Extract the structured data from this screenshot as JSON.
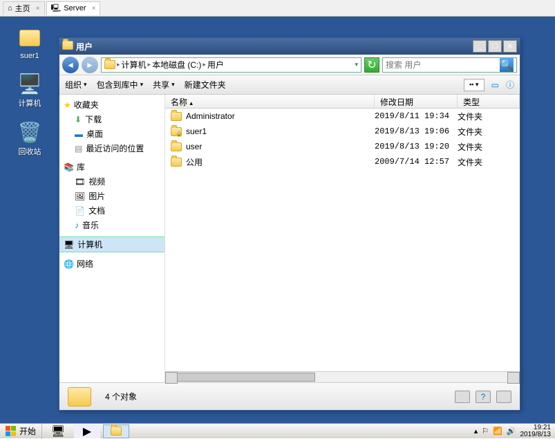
{
  "tabs": [
    {
      "label": "主页",
      "active": false
    },
    {
      "label": "Server",
      "active": true
    }
  ],
  "desktop_icons": [
    {
      "label": "suer1",
      "glyph": "👤"
    },
    {
      "label": "计算机",
      "glyph": "🖥️"
    },
    {
      "label": "回收站",
      "glyph": "🗑️"
    }
  ],
  "window": {
    "title": "用户",
    "breadcrumb": [
      "计算机",
      "本地磁盘 (C:)",
      "用户"
    ],
    "search_placeholder": "搜索 用户",
    "toolbar": {
      "organize": "组织",
      "include": "包含到库中",
      "share": "共享",
      "newfolder": "新建文件夹"
    },
    "sidebar": {
      "favorites": {
        "label": "收藏夹",
        "items": [
          "下载",
          "桌面",
          "最近访问的位置"
        ]
      },
      "libraries": {
        "label": "库",
        "items": [
          "视频",
          "图片",
          "文档",
          "音乐"
        ]
      },
      "computer": "计算机",
      "network": "网络"
    },
    "columns": {
      "name": "名称",
      "date": "修改日期",
      "type": "类型"
    },
    "rows": [
      {
        "name": "Administrator",
        "date": "2019/8/11 19:34",
        "type": "文件夹"
      },
      {
        "name": "suer1",
        "date": "2019/8/13 19:06",
        "type": "文件夹"
      },
      {
        "name": "user",
        "date": "2019/8/13 19:20",
        "type": "文件夹"
      },
      {
        "name": "公用",
        "date": "2009/7/14 12:57",
        "type": "文件夹"
      }
    ],
    "status": "4 个对象"
  },
  "taskbar": {
    "start": "开始",
    "time": "19:21",
    "date": "2019/8/13"
  }
}
